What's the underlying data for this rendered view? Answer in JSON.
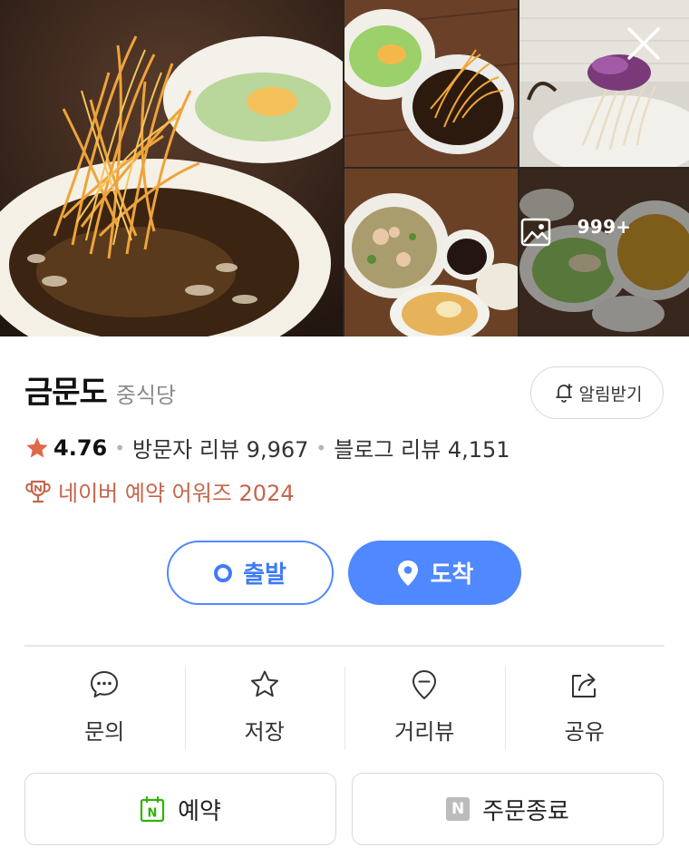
{
  "gallery": {
    "more_count": "999+"
  },
  "place": {
    "name": "금문도",
    "category": "중식당"
  },
  "alert_button": {
    "label": "알림받기"
  },
  "stats": {
    "rating": "4.76",
    "visitor_reviews": "방문자 리뷰 9,967",
    "blog_reviews": "블로그 리뷰 4,151"
  },
  "award": {
    "text": "네이버 예약 어워즈 2024"
  },
  "route": {
    "depart_label": "출발",
    "arrive_label": "도착"
  },
  "actions": [
    {
      "label": "문의",
      "icon": "chat-bubble-icon"
    },
    {
      "label": "저장",
      "icon": "star-outline-icon"
    },
    {
      "label": "거리뷰",
      "icon": "street-view-pin-icon"
    },
    {
      "label": "공유",
      "icon": "share-icon"
    }
  ],
  "bottom": {
    "reserve_label": "예약",
    "reserve_badge": "N",
    "order_label": "주문종료",
    "order_badge": "N"
  },
  "colors": {
    "accent_blue": "#4f88ff",
    "rating_star": "#e0684b",
    "award_text": "#c4654b",
    "reserve_green": "#2db400"
  }
}
